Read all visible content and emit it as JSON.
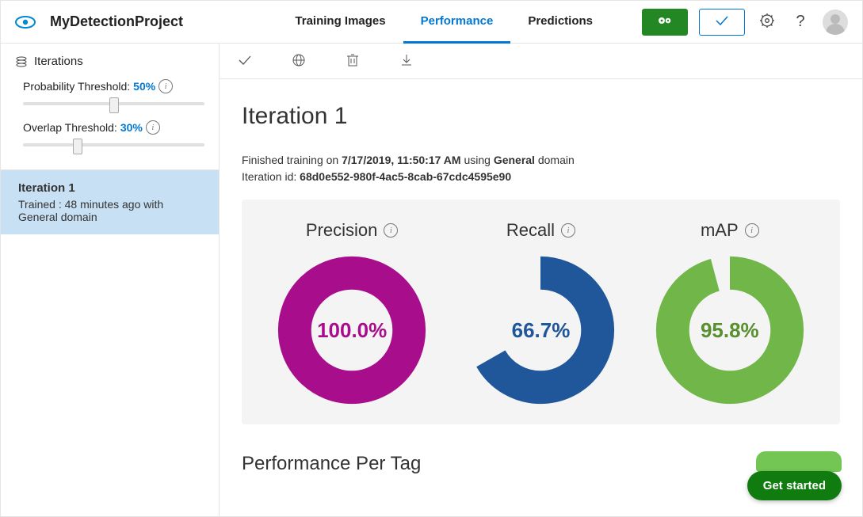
{
  "header": {
    "project": "MyDetectionProject",
    "tabs": {
      "training": "Training Images",
      "performance": "Performance",
      "predictions": "Predictions"
    }
  },
  "sidebar": {
    "iterations_label": "Iterations",
    "probability": {
      "label": "Probability Threshold:",
      "value": "50%",
      "pct": 50
    },
    "overlap": {
      "label": "Overlap Threshold:",
      "value": "30%",
      "pct": 30
    },
    "iteration": {
      "name": "Iteration 1",
      "trained_prefix": "Trained : ",
      "trained_rest": "48 minutes ago with General domain"
    }
  },
  "main": {
    "iteration_title": "Iteration 1",
    "finished_prefix": "Finished training on ",
    "finished_date": "7/17/2019, 11:50:17 AM",
    "finished_using": " using ",
    "finished_domain": "General",
    "finished_suffix": " domain",
    "iter_id_prefix": "Iteration id: ",
    "iter_id": "68d0e552-980f-4ac5-8cab-67cdc4595e90",
    "metrics": {
      "precision": {
        "label": "Precision",
        "value": 100.0,
        "text": "100.0%",
        "color": "#a80e8c"
      },
      "recall": {
        "label": "Recall",
        "value": 66.7,
        "text": "66.7%",
        "color": "#20569a"
      },
      "map": {
        "label": "mAP",
        "value": 95.8,
        "text": "95.8%",
        "color": "#71b648"
      }
    },
    "perf_per_tag": "Performance Per Tag",
    "get_started": "Get started"
  },
  "chart_data": [
    {
      "type": "pie",
      "title": "Precision",
      "categories": [
        "value",
        "remainder"
      ],
      "values": [
        100.0,
        0.0
      ],
      "ylim": [
        0,
        100
      ],
      "color": "#a80e8c"
    },
    {
      "type": "pie",
      "title": "Recall",
      "categories": [
        "value",
        "remainder"
      ],
      "values": [
        66.7,
        33.3
      ],
      "ylim": [
        0,
        100
      ],
      "color": "#20569a"
    },
    {
      "type": "pie",
      "title": "mAP",
      "categories": [
        "value",
        "remainder"
      ],
      "values": [
        95.8,
        4.2
      ],
      "ylim": [
        0,
        100
      ],
      "color": "#71b648"
    }
  ]
}
